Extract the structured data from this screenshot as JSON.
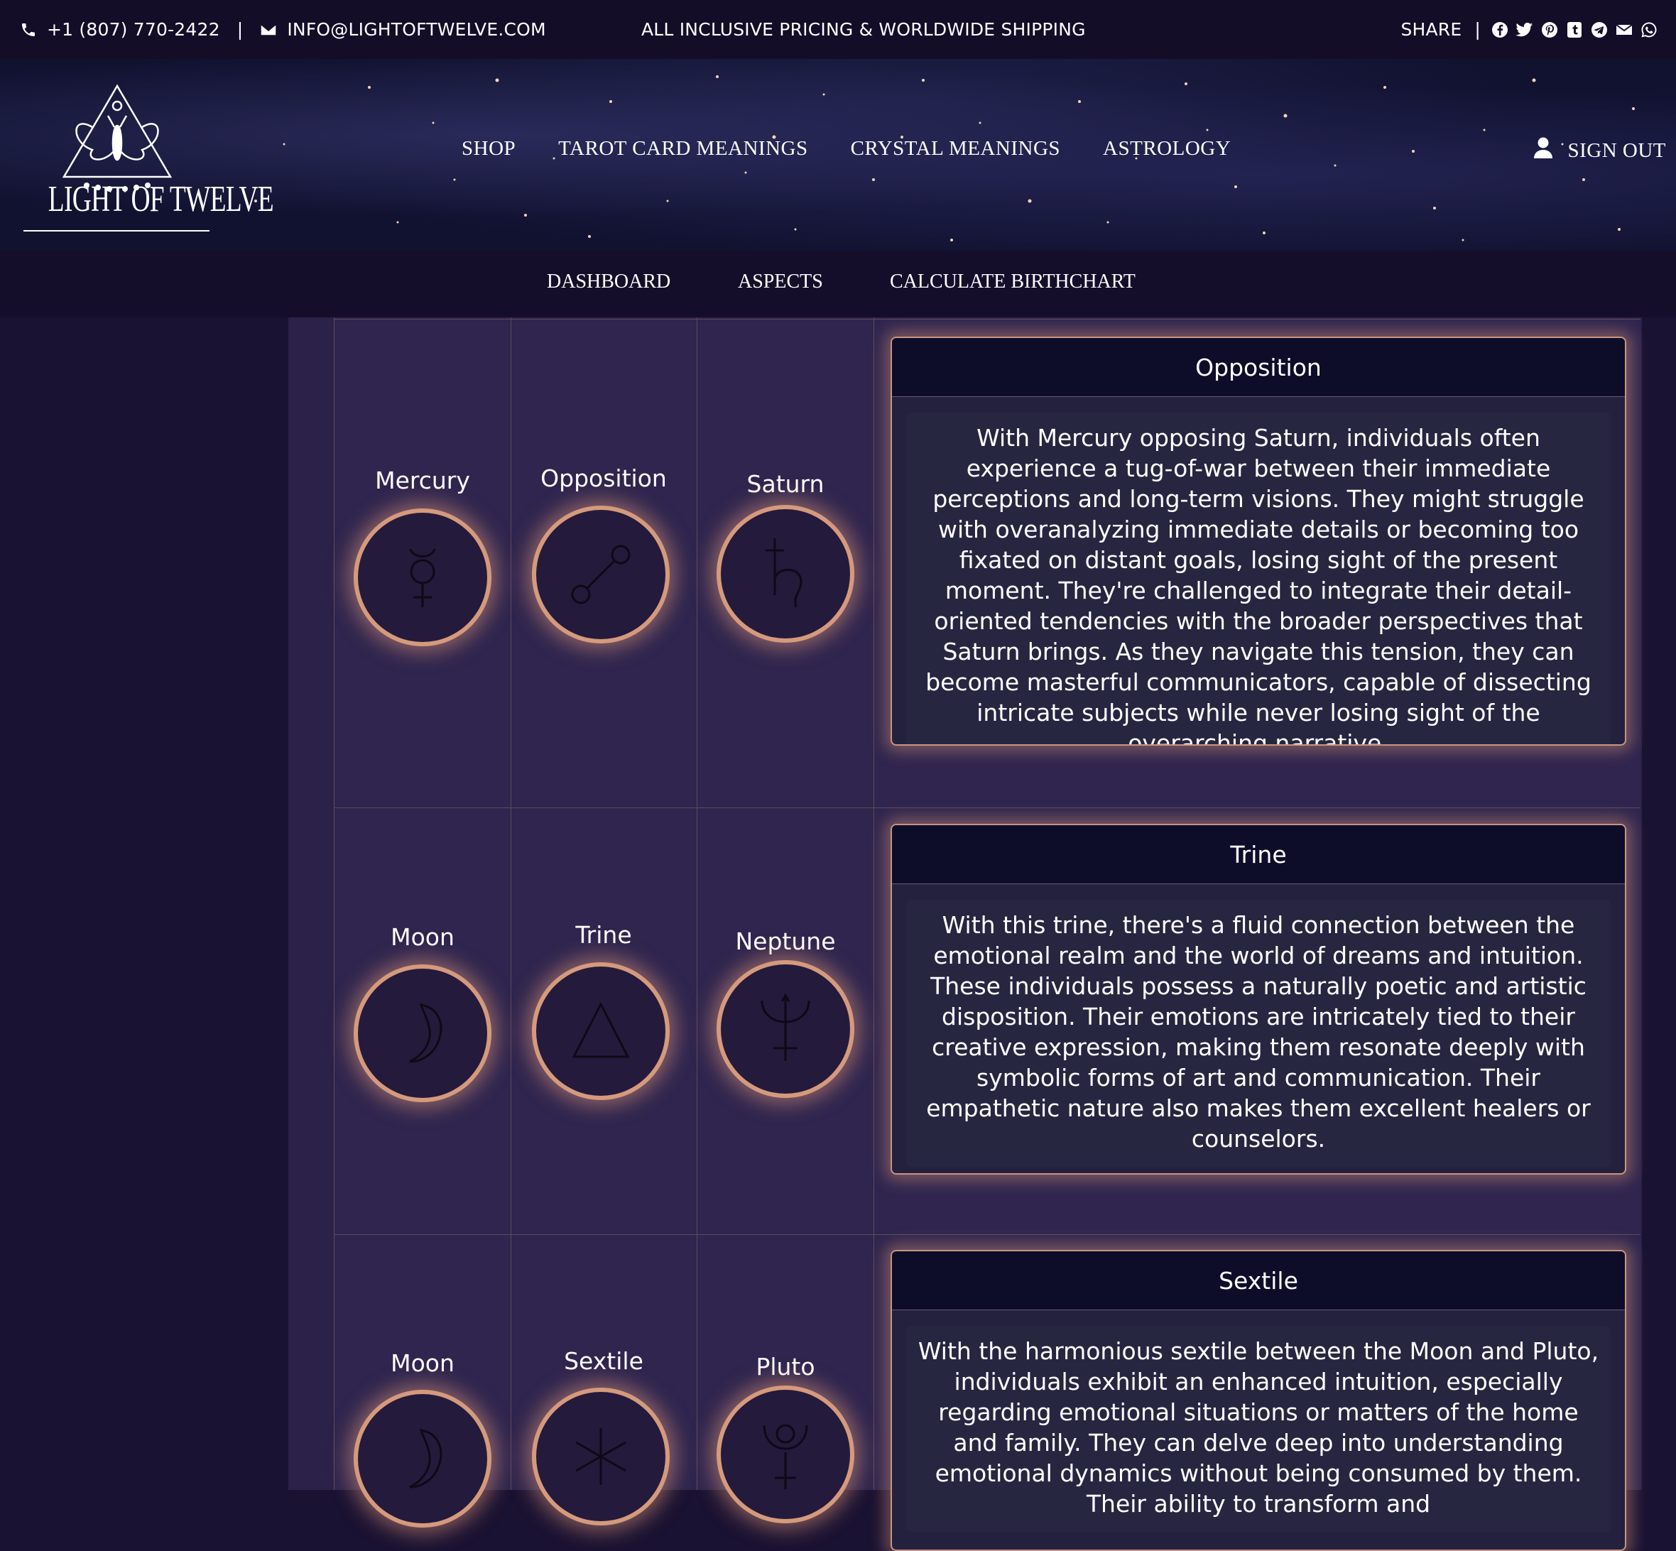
{
  "topbar": {
    "phone": "+1 (807) 770-2422",
    "separator": "|",
    "email": "INFO@LIGHTOFTWELVE.COM",
    "promo": "ALL INCLUSIVE PRICING & WORLDWIDE SHIPPING",
    "share_label": "SHARE",
    "share_sep": "|",
    "social_icons": [
      "facebook-icon",
      "twitter-icon",
      "pinterest-icon",
      "tumblr-icon",
      "telegram-icon",
      "email-icon",
      "whatsapp-icon"
    ]
  },
  "brand": {
    "name": "LIGHT OF TWELVE"
  },
  "mainnav": [
    "SHOP",
    "TAROT CARD MEANINGS",
    "CRYSTAL MEANINGS",
    "ASTROLOGY"
  ],
  "account": {
    "signout": "SIGN OUT"
  },
  "subnav": [
    "DASHBOARD",
    "ASPECTS",
    "CALCULATE BIRTHCHART"
  ],
  "aspects": [
    {
      "planet1": "Mercury",
      "aspect": "Opposition",
      "planet2": "Saturn",
      "title": "Opposition",
      "text": "With Mercury opposing Saturn, individuals often experience a tug-of-war between their immediate perceptions and long-term visions. They might struggle with overanalyzing immediate details or becoming too fixated on distant goals, losing sight of the present moment. They're challenged to integrate their detail-oriented tendencies with the broader perspectives that Saturn brings. As they navigate this tension, they can become masterful communicators, capable of dissecting intricate subjects while never losing sight of the overarching narrative."
    },
    {
      "planet1": "Moon",
      "aspect": "Trine",
      "planet2": "Neptune",
      "title": "Trine",
      "text": "With this trine, there's a fluid connection between the emotional realm and the world of dreams and intuition. These individuals possess a naturally poetic and artistic disposition. Their emotions are intricately tied to their creative expression, making them resonate deeply with symbolic forms of art and communication. Their empathetic nature also makes them excellent healers or counselors."
    },
    {
      "planet1": "Moon",
      "aspect": "Sextile",
      "planet2": "Pluto",
      "title": "Sextile",
      "text": "With the harmonious sextile between the Moon and Pluto, individuals exhibit an enhanced intuition, especially regarding emotional situations or matters of the home and family. They can delve deep into understanding emotional dynamics without being consumed by them. Their ability to transform and"
    }
  ]
}
